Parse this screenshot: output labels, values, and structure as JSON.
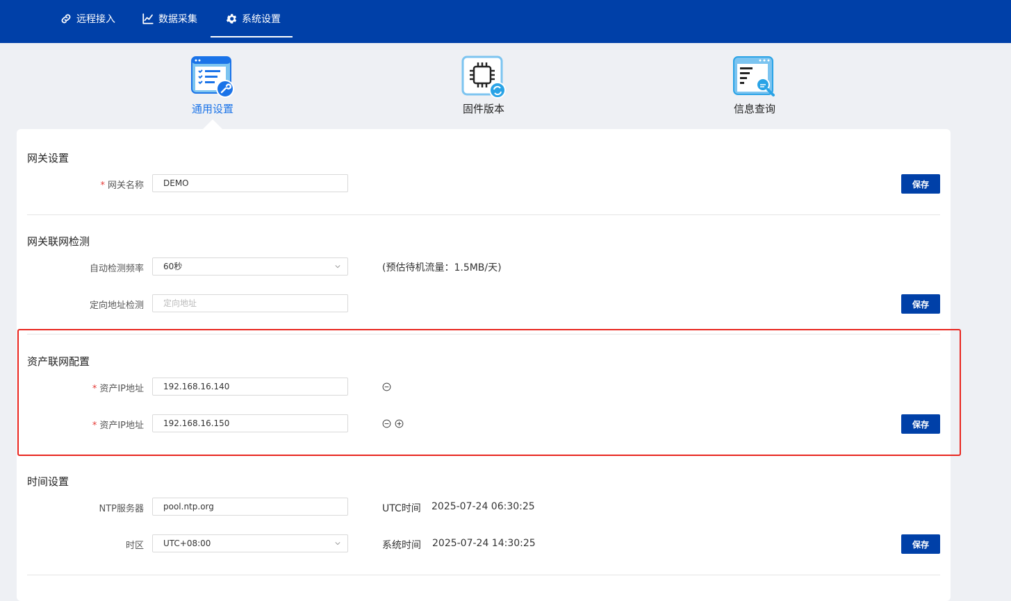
{
  "nav": {
    "items": [
      {
        "label": "远程接入",
        "icon": "link-icon"
      },
      {
        "label": "数据采集",
        "icon": "chart-icon"
      },
      {
        "label": "系统设置",
        "icon": "gear-icon"
      }
    ]
  },
  "tabs": [
    {
      "label": "通用设置",
      "icon": "settings-list-icon",
      "active": true
    },
    {
      "label": "固件版本",
      "icon": "chip-icon",
      "active": false
    },
    {
      "label": "信息查询",
      "icon": "search-doc-icon",
      "active": false
    }
  ],
  "gateway": {
    "title": "网关设置",
    "name_label": "网关名称",
    "name_value": "DEMO",
    "save_label": "保存"
  },
  "network_check": {
    "title": "网关联网检测",
    "freq_label": "自动检测频率",
    "freq_value": "60秒",
    "traffic_note": "(预估待机流量：1.5MB/天)",
    "addr_label": "定向地址检测",
    "addr_placeholder": "定向地址",
    "save_label": "保存"
  },
  "asset": {
    "title": "资产联网配置",
    "ip_label_1": "资产IP地址",
    "ip_value_1": "192.168.16.140",
    "ip_label_2": "资产IP地址",
    "ip_value_2": "192.168.16.150",
    "save_label": "保存"
  },
  "time": {
    "title": "时间设置",
    "ntp_label": "NTP服务器",
    "ntp_value": "pool.ntp.org",
    "utc_label": "UTC时间",
    "utc_value": "2025-07-24 06:30:25",
    "tz_label": "时区",
    "tz_value": "UTC+08:00",
    "sys_label": "系统时间",
    "sys_value": "2025-07-24 14:30:25",
    "save_label": "保存"
  },
  "colors": {
    "brand": "#0040a8",
    "accent": "#1a73e8",
    "highlight": "#e8241d"
  }
}
